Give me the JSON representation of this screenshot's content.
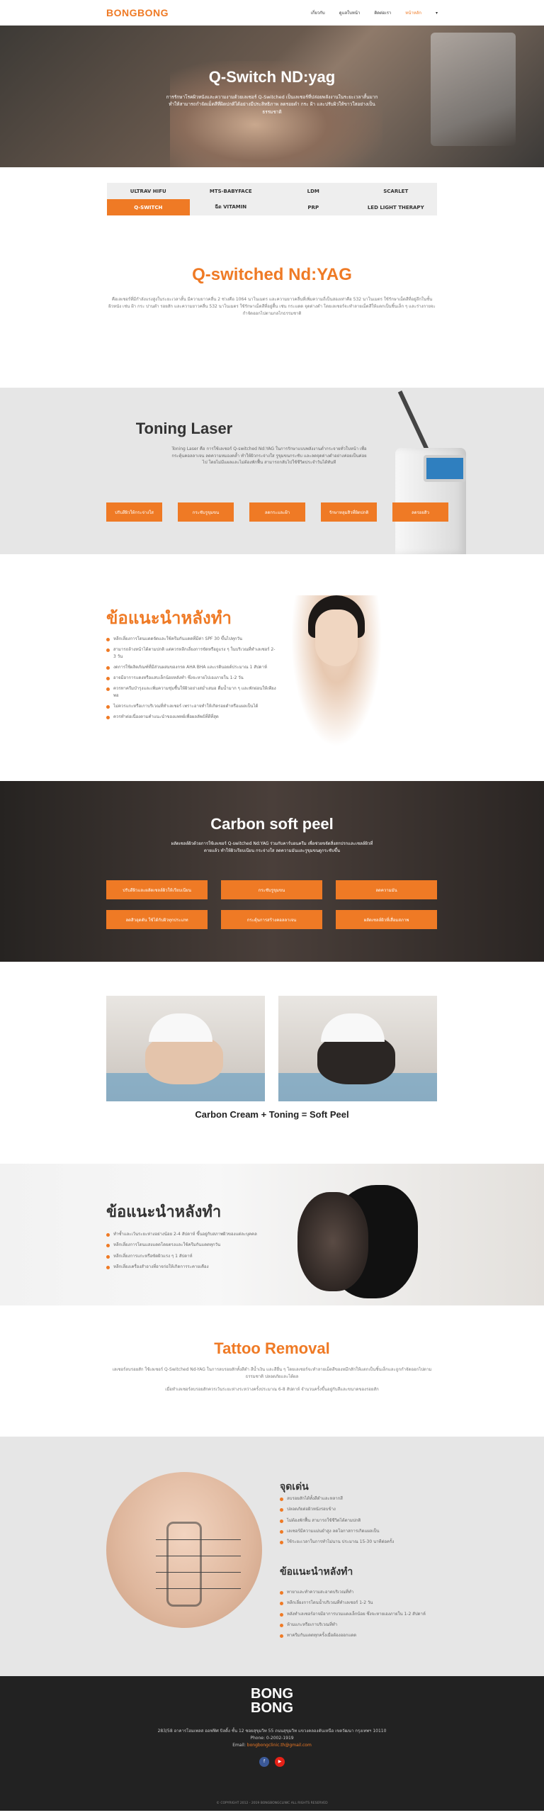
{
  "header": {
    "logo": "BONGBONG",
    "nav": [
      "เกี่ยวกับ",
      "ดูแลใบหน้า",
      "ติดต่อเรา",
      "หน้าหลัก",
      "▾"
    ],
    "active_index": 3
  },
  "hero": {
    "title": "Q-Switch ND:yag",
    "description": "การรักษาโรคผิวหนังและความงามด้วยเลเซอร์ Q-Switched เป็นเลเซอร์ที่ปล่อยพลังงานในระยะเวลาสั้นมาก ทำให้สามารถกำจัดเม็ดสีที่ผิดปกติได้อย่างมีประสิทธิภาพ ลดรอยดำ กระ ฝ้า และปรับผิวให้ขาวใสอย่างเป็นธรรมชาติ"
  },
  "tabs": [
    "ULTRAV HIFU",
    "MTS-BABYFACE",
    "LDM",
    "SCARLET",
    "Q-SWITCH",
    "ฉีด VITAMIN",
    "PRP",
    "LED LIGHT THERAPY"
  ],
  "active_tab": 4,
  "qswitch": {
    "title": "Q-switched Nd:YAG",
    "text": "คือเลเซอร์ที่มีกำลังแรงสูงในระยะเวลาสั้น มีความยาวคลื่น 2 ช่วงคือ 1064 นาโนเมตร และความยาวคลื่นที่เพิ่มความถี่เป็นสองเท่าคือ 532 นาโนเมตร ใช้รักษาเม็ดสีที่อยู่ลึกในชั้นผิวหนัง เช่น ฝ้า กระ ปานดำ รอยสัก และความยาวคลื่น 532 นาโนเมตร ใช้รักษาเม็ดสีที่อยู่ตื้น เช่น กระแดด จุดด่างดำ โดยเลเซอร์จะทำลายเม็ดสีให้แตกเป็นชิ้นเล็ก ๆ และร่างกายจะกำจัดออกไปตามกลไกธรรมชาติ"
  },
  "toning": {
    "title": "Toning Laser",
    "text": "Toning Laser คือ การใช้เลเซอร์ Q-switched Nd:YAG ในการรักษาแบบพลังงานต่ำกระจายทั่วใบหน้า เพื่อกระตุ้นคอลลาเจน ลดความหมองคล้ำ ทำให้ผิวกระจ่างใส รูขุมขนกระชับ และลดจุดด่างดำอย่างค่อยเป็นค่อยไป โดยไม่มีแผลและไม่ต้องพักฟื้น สามารถกลับไปใช้ชีวิตประจำวันได้ทันที",
    "buttons": [
      "ปรับสีผิวให้กระจ่างใส",
      "กระชับรูขุมขน",
      "ลดกระและฝ้า",
      "รักษาหลุมสิวที่ผิดปกติ",
      "ลดรอยสิว"
    ]
  },
  "advice1": {
    "title": "ข้อแนะนำหลังทำ",
    "items": [
      "หลีกเลี่ยงการโดนแดดจัดและใช้ครีมกันแดดที่มีค่า SPF 30 ขึ้นไปทุกวัน",
      "สามารถล้างหน้าได้ตามปกติ แต่ควรหลีกเลี่ยงการขัดหรือถูแรง ๆ ในบริเวณที่ทำเลเซอร์ 2-3 วัน",
      "งดการใช้ผลิตภัณฑ์ที่มีส่วนผสมของกรด AHA BHA และเรตินอยด์ประมาณ 1 สัปดาห์",
      "อาจมีอาการแดงหรือแสบเล็กน้อยหลังทำ ซึ่งจะหายไปเองภายใน 1-2 วัน",
      "ควรทาครีมบำรุงและเพิ่มความชุ่มชื้นให้ผิวอย่างสม่ำเสมอ ดื่มน้ำมาก ๆ และพักผ่อนให้เพียงพอ",
      "ไม่ควรแกะหรือเกาบริเวณที่ทำเลเซอร์ เพราะอาจทำให้เกิดรอยดำหรือแผลเป็นได้",
      "ควรทำต่อเนื่องตามคำแนะนำของแพทย์เพื่อผลลัพธ์ที่ดีที่สุด"
    ]
  },
  "carbon": {
    "title": "Carbon soft peel",
    "text": "ผลัดเซลล์ผิวด้วยการใช้เลเซอร์ Q-switched Nd:YAG ร่วมกับคาร์บอนครีม เพื่อช่วยขจัดสิ่งสกปรกและเซลล์ผิวที่ตายแล้ว ทำให้ผิวเรียบเนียน กระจ่างใส ลดความมันและรูขุมขนดูกระชับขึ้น",
    "buttons": [
      "ปรับสีผิวและผลัดเซลล์ผิวให้เรียบเนียน",
      "กระชับรูขุมขน",
      "ลดความมัน",
      "ลดสิวอุดตัน ใช้ได้กับผิวทุกประเภท",
      "กระตุ้นการสร้างคอลลาเจน",
      "ผลัดเซลล์ผิวที่เสื่อมสภาพ"
    ]
  },
  "photos": {
    "caption": "Carbon Cream + Toning = Soft Peel"
  },
  "advice2": {
    "title": "ข้อแนะนำหลังทำ",
    "items": [
      "ทำซ้ำและเว้นระยะห่างอย่างน้อย 2-4 สัปดาห์ ขึ้นอยู่กับสภาพผิวของแต่ละบุคคล",
      "หลีกเลี่ยงการโดนแสงแดดโดยตรงและใช้ครีมกันแดดทุกวัน",
      "หลีกเลี่ยงการแกะหรือขัดผิวแรง ๆ 1 สัปดาห์",
      "หลีกเลี่ยงเครื่องสำอางที่อาจก่อให้เกิดการระคายเคือง"
    ]
  },
  "tattoo": {
    "title": "Tattoo Removal",
    "text1": "เลเซอร์ลบรอยสัก ใช้เลเซอร์ Q-Switched Nd-YAG ในการลบรอยสักทั้งสีดำ สีน้ำเงิน และสีอื่น ๆ โดยเลเซอร์จะทำลายเม็ดสีของหมึกสักให้แตกเป็นชิ้นเล็กและถูกกำจัดออกไปตามธรรมชาติ ปลอดภัยและได้ผล",
    "text2": "เมื่อทำเลเซอร์ลบรอยสักควรเว้นระยะห่างระหว่างครั้งประมาณ 6-8 สัปดาห์ จำนวนครั้งขึ้นอยู่กับสีและขนาดของรอยสัก"
  },
  "back": {
    "heading1": "จุดเด่น",
    "items1": [
      "ลบรอยสักได้ทั้งสีดำและหลากสี",
      "ปลอดภัยต่อผิวหนังรอบข้าง",
      "ไม่ต้องพักฟื้น สามารถใช้ชีวิตได้ตามปกติ",
      "เลเซอร์มีความแม่นยำสูง ลดโอกาสการเกิดแผลเป็น",
      "ใช้ระยะเวลาในการทำไม่นาน ประมาณ 15-30 นาทีต่อครั้ง"
    ],
    "heading2": "ข้อแนะนำหลังทำ",
    "items2": [
      "ทายาและทำความสะอาดบริเวณที่ทำ",
      "หลีกเลี่ยงการโดนน้ำบริเวณที่ทำเลเซอร์ 1-2 วัน",
      "หลังทำเลเซอร์อาจมีอาการบวมแดงเล็กน้อย ซึ่งจะหายเองภายใน 1-2 สัปดาห์",
      "ห้ามแกะหรือเกาบริเวณที่ทำ",
      "ทาครีมกันแดดทุกครั้งเมื่อต้องออกแดด"
    ]
  },
  "footer": {
    "logo_top": "BONG",
    "logo_bottom": "BONG",
    "address": "283/58 อาคารโฮมเพลส ออฟฟิศ บิลดิ้ง ชั้น 12 ซอยสุขุมวิท 55 ถนนสุขุมวิท แขวงคลองตันเหนือ เขตวัฒนา กรุงเทพฯ 10110",
    "phone": "Phone: 0-2002-1919",
    "email_label": "Email:",
    "email": "bongbongclinic.th@gmail.com",
    "social": [
      "f",
      "▶"
    ],
    "copyright": "© COPYRIGHT 2012 - 2019 BONGBONGCLINIC ALL RIGHTS RESERVED"
  },
  "colors": {
    "accent": "#ef7a25",
    "dark": "#222222",
    "facebook": "#3b5998",
    "youtube": "#e62117"
  }
}
